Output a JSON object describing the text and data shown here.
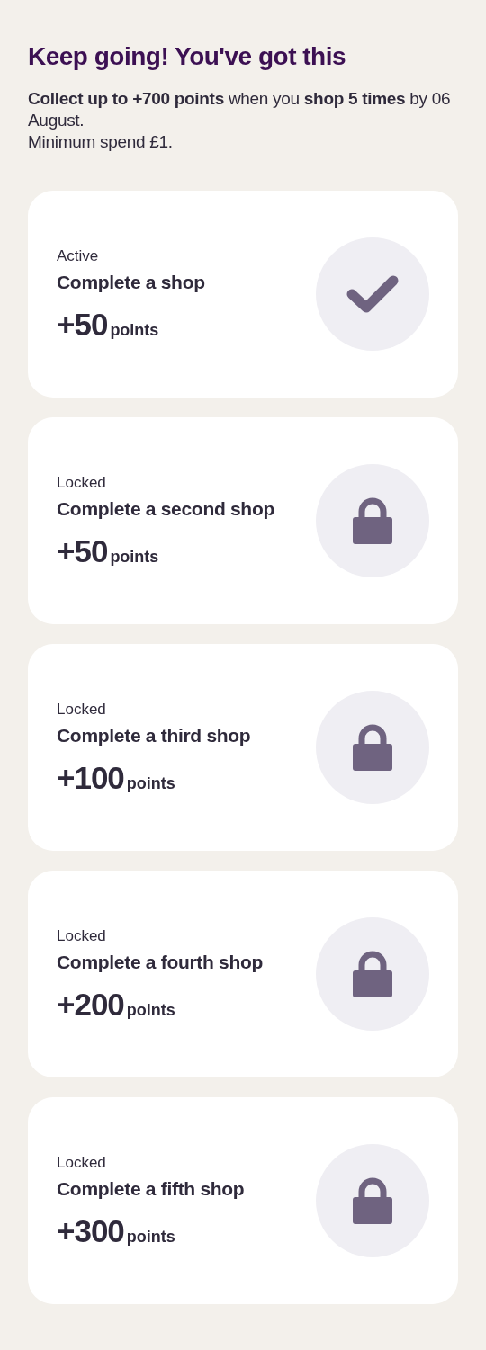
{
  "heading": "Keep going! You've got this",
  "description": "**Collect up to +700 points** when you **shop 5 times** by 06 August.",
  "note": "Minimum spend £1.",
  "tasks": [
    {
      "status": "Active",
      "title": "Complete a shop",
      "amount": "+50",
      "unit": "points",
      "kind": "check"
    },
    {
      "status": "Locked",
      "title": "Complete a second shop",
      "amount": "+50",
      "unit": "points",
      "kind": "lock"
    },
    {
      "status": "Locked",
      "title": "Complete a third shop",
      "amount": "+100",
      "unit": "points",
      "kind": "lock"
    },
    {
      "status": "Locked",
      "title": "Complete a fourth shop",
      "amount": "+200",
      "unit": "points",
      "kind": "lock"
    },
    {
      "status": "Locked",
      "title": "Complete a fifth shop",
      "amount": "+300",
      "unit": "points",
      "kind": "lock"
    }
  ]
}
